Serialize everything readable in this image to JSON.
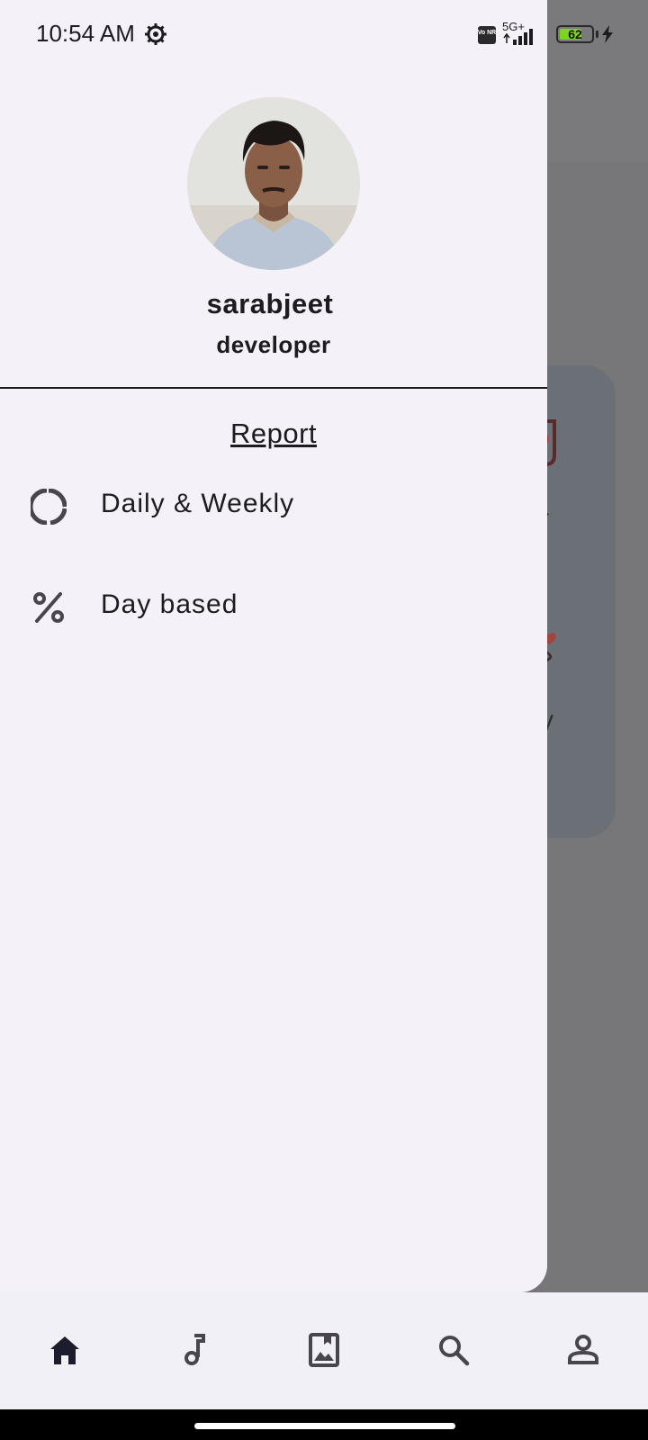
{
  "status_bar": {
    "time": "10:54 AM",
    "network": "5G+",
    "volte": "Vo NR",
    "battery": "62",
    "battery_level": 0.62,
    "icons": [
      "settings-gear-icon",
      "signal-icon",
      "battery-icon",
      "charging-bolt-icon"
    ]
  },
  "drawer": {
    "profile": {
      "name": "sarabjeet",
      "role": "developer"
    },
    "section_title": "Report",
    "menu_items": [
      {
        "label": "Daily & Weekly",
        "icon": "donut-chart-icon"
      },
      {
        "label": "Day based",
        "icon": "percent-icon"
      }
    ]
  },
  "background": {
    "text_1": "r",
    "text_2": "y"
  },
  "bottom_nav": {
    "items": [
      {
        "icon": "home-icon",
        "active": true
      },
      {
        "icon": "music-note-icon",
        "active": false
      },
      {
        "icon": "photo-bookmark-icon",
        "active": false
      },
      {
        "icon": "search-icon",
        "active": false
      },
      {
        "icon": "person-icon",
        "active": false
      }
    ]
  },
  "colors": {
    "drawer_bg": "#f5f1f8",
    "scrim": "#777678",
    "text": "#1d1b20",
    "nav_bg": "#f2f0f7"
  }
}
